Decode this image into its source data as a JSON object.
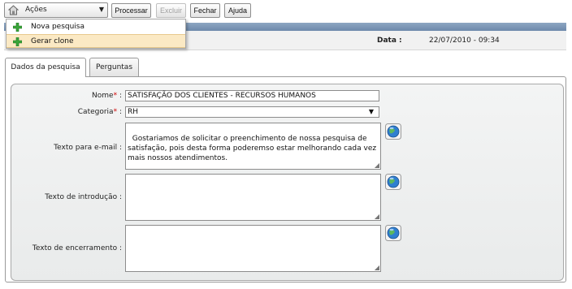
{
  "toolbar": {
    "acoes_label": "Ações",
    "processar_label": "Processar",
    "excluir_label": "Excluir",
    "fechar_label": "Fechar",
    "ajuda_label": "Ajuda"
  },
  "menu": {
    "items": [
      {
        "label": "Nova pesquisa"
      },
      {
        "label": "Gerar clone"
      }
    ]
  },
  "header": {
    "date_label": "Data :",
    "date_value": "22/07/2010 - 09:34"
  },
  "tabs": [
    {
      "label": "Dados da pesquisa",
      "active": true
    },
    {
      "label": "Perguntas",
      "active": false
    }
  ],
  "form": {
    "nome_label": "Nome",
    "nome_value": "SATISFAÇÃO DOS CLIENTES - RECURSOS HUMANOS",
    "categoria_label": "Categoria",
    "categoria_value": "RH",
    "email_label": "Texto para e-mail :",
    "email_value": "Gostariamos de solicitar o preenchimento de nossa pesquisa de satisfação, pois desta forma poderemso estar melhorando cada vez mais nossos atendimentos.",
    "intro_label": "Texto de introdução :",
    "intro_value": "",
    "encerramento_label": "Texto de encerramento :",
    "encerramento_value": "",
    "required_mark": "*",
    "colon": ":"
  },
  "colors": {
    "header_band": "#7590b2",
    "menu_highlight": "#fbe9c4",
    "required": "#d00000"
  },
  "icons": [
    "house-icon",
    "chevron-down-icon",
    "plus-icon",
    "globe-icon",
    "resize-grip-icon"
  ]
}
